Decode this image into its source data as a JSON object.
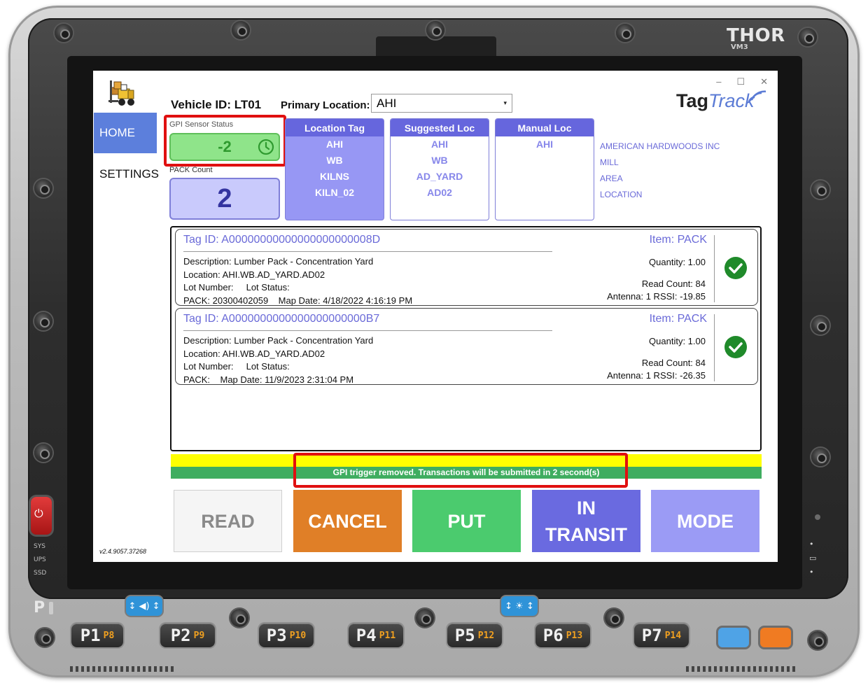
{
  "device": {
    "brand": "THOR",
    "model": "VM3",
    "side_labels": [
      "SYS",
      "UPS",
      "SSD"
    ],
    "p_indicator": "P",
    "keys": [
      {
        "label": "P1",
        "alt": "P8"
      },
      {
        "label": "P2",
        "alt": "P9"
      },
      {
        "label": "P3",
        "alt": "P10"
      },
      {
        "label": "P4",
        "alt": "P11"
      },
      {
        "label": "P5",
        "alt": "P12"
      },
      {
        "label": "P6",
        "alt": "P13"
      },
      {
        "label": "P7",
        "alt": "P14"
      }
    ],
    "volume_key": "↕ ◀) ↕",
    "brightness_key": "↕ ☀ ↕",
    "right_icons": [
      "•",
      "▭",
      "•"
    ]
  },
  "window": {
    "minimize": "–",
    "maximize": "☐",
    "close": "✕"
  },
  "nav": {
    "home": "HOME",
    "settings": "SETTINGS",
    "version": "v2.4.9057.37268"
  },
  "header": {
    "vehicle_label": "Vehicle ID:",
    "vehicle_id": "LT01",
    "primary_location_label": "Primary Location:",
    "primary_location_value": "AHI",
    "logo_tag": "Tag",
    "logo_track": "Track"
  },
  "gpi": {
    "label": "GPI Sensor Status",
    "value": "-2",
    "status_color": "#8fe48a"
  },
  "pack": {
    "label": "PACK Count",
    "value": "2"
  },
  "location_columns": [
    {
      "header": "Location Tag",
      "rows": [
        "AHI",
        "WB",
        "KILNS",
        "KILN_02"
      ]
    },
    {
      "header": "Suggested Loc",
      "rows": [
        "AHI",
        "WB",
        "AD_YARD",
        "AD02"
      ]
    },
    {
      "header": "Manual Loc",
      "rows": [
        "AHI"
      ]
    }
  ],
  "location_levels": [
    "AMERICAN HARDWOODS INC",
    "MILL",
    "AREA",
    "LOCATION"
  ],
  "tags": [
    {
      "tag_id": "Tag ID: A00000000000000000000008D",
      "description": "Description: Lumber Pack - Concentration Yard",
      "location": "Location: AHI.WB.AD_YARD.AD02",
      "lot": "Lot Number:     Lot Status:",
      "pack": "PACK: 20300402059    Map Date: 4/18/2022 4:16:19 PM",
      "item": "Item: PACK",
      "quantity": "Quantity: 1.00",
      "read_count": "Read Count: 84",
      "antenna": "Antenna: 1  RSSI: -19.85"
    },
    {
      "tag_id": "Tag ID: A0000000000000000000000B7",
      "description": "Description: Lumber Pack - Concentration Yard",
      "location": "Location: AHI.WB.AD_YARD.AD02",
      "lot": "Lot Number:     Lot Status:",
      "pack": "PACK:    Map Date: 11/9/2023 2:31:04 PM",
      "item": "Item: PACK",
      "quantity": "Quantity: 1.00",
      "read_count": "Read Count: 84",
      "antenna": "Antenna: 1  RSSI: -26.35"
    }
  ],
  "status_message": "GPI trigger removed. Transactions will be submitted in 2 second(s)",
  "actions": {
    "read": "READ",
    "cancel": "CANCEL",
    "put": "PUT",
    "in_transit_1": "IN",
    "in_transit_2": "TRANSIT",
    "mode": "MODE"
  },
  "colors": {
    "accent": "#5c7fdc",
    "cancel": "#e07f27",
    "put": "#4bcb6e",
    "transit": "#6a6ae0",
    "mode": "#9b9bf5",
    "highlight": "#e01010"
  }
}
